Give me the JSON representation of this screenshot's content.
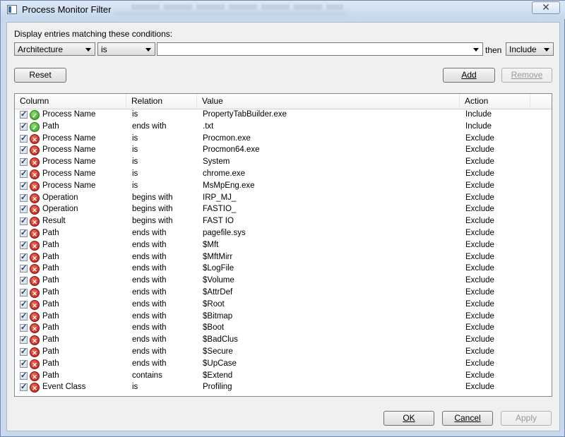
{
  "window": {
    "title": "Process Monitor Filter",
    "close_glyph": "✕"
  },
  "condition": {
    "label": "Display entries matching these conditions:",
    "column_value": "Architecture",
    "relation_value": "is",
    "value_value": "",
    "then_label": "then",
    "action_value": "Include"
  },
  "buttons": {
    "reset": "Reset",
    "add": "Add",
    "remove": "Remove",
    "ok": "OK",
    "cancel": "Cancel",
    "apply": "Apply"
  },
  "table": {
    "headers": [
      "Column",
      "Relation",
      "Value",
      "Action"
    ],
    "rows": [
      {
        "column": "Process Name",
        "relation": "is",
        "value": "PropertyTabBuilder.exe",
        "action": "Include",
        "type": "include"
      },
      {
        "column": "Path",
        "relation": "ends with",
        ".txt": "",
        "value": ".txt",
        "action": "Include",
        "type": "include"
      },
      {
        "column": "Process Name",
        "relation": "is",
        "value": "Procmon.exe",
        "action": "Exclude",
        "type": "exclude"
      },
      {
        "column": "Process Name",
        "relation": "is",
        "value": "Procmon64.exe",
        "action": "Exclude",
        "type": "exclude"
      },
      {
        "column": "Process Name",
        "relation": "is",
        "value": "System",
        "action": "Exclude",
        "type": "exclude"
      },
      {
        "column": "Process Name",
        "relation": "is",
        "value": "chrome.exe",
        "action": "Exclude",
        "type": "exclude"
      },
      {
        "column": "Process Name",
        "relation": "is",
        "value": "MsMpEng.exe",
        "action": "Exclude",
        "type": "exclude"
      },
      {
        "column": "Operation",
        "relation": "begins with",
        "value": "IRP_MJ_",
        "action": "Exclude",
        "type": "exclude"
      },
      {
        "column": "Operation",
        "relation": "begins with",
        "value": "FASTIO_",
        "action": "Exclude",
        "type": "exclude"
      },
      {
        "column": "Result",
        "relation": "begins with",
        "value": "FAST IO",
        "action": "Exclude",
        "type": "exclude"
      },
      {
        "column": "Path",
        "relation": "ends with",
        "value": "pagefile.sys",
        "action": "Exclude",
        "type": "exclude"
      },
      {
        "column": "Path",
        "relation": "ends with",
        "value": "$Mft",
        "action": "Exclude",
        "type": "exclude"
      },
      {
        "column": "Path",
        "relation": "ends with",
        "value": "$MftMirr",
        "action": "Exclude",
        "type": "exclude"
      },
      {
        "column": "Path",
        "relation": "ends with",
        "value": "$LogFile",
        "action": "Exclude",
        "type": "exclude"
      },
      {
        "column": "Path",
        "relation": "ends with",
        "value": "$Volume",
        "action": "Exclude",
        "type": "exclude"
      },
      {
        "column": "Path",
        "relation": "ends with",
        "value": "$AttrDef",
        "action": "Exclude",
        "type": "exclude"
      },
      {
        "column": "Path",
        "relation": "ends with",
        "value": "$Root",
        "action": "Exclude",
        "type": "exclude"
      },
      {
        "column": "Path",
        "relation": "ends with",
        "value": "$Bitmap",
        "action": "Exclude",
        "type": "exclude"
      },
      {
        "column": "Path",
        "relation": "ends with",
        "value": "$Boot",
        "action": "Exclude",
        "type": "exclude"
      },
      {
        "column": "Path",
        "relation": "ends with",
        "value": "$BadClus",
        "action": "Exclude",
        "type": "exclude"
      },
      {
        "column": "Path",
        "relation": "ends with",
        "value": "$Secure",
        "action": "Exclude",
        "type": "exclude"
      },
      {
        "column": "Path",
        "relation": "ends with",
        "value": "$UpCase",
        "action": "Exclude",
        "type": "exclude"
      },
      {
        "column": "Path",
        "relation": "contains",
        "value": "$Extend",
        "action": "Exclude",
        "type": "exclude"
      },
      {
        "column": "Event Class",
        "relation": "is",
        "value": "Profiling",
        "action": "Exclude",
        "type": "exclude"
      }
    ]
  }
}
